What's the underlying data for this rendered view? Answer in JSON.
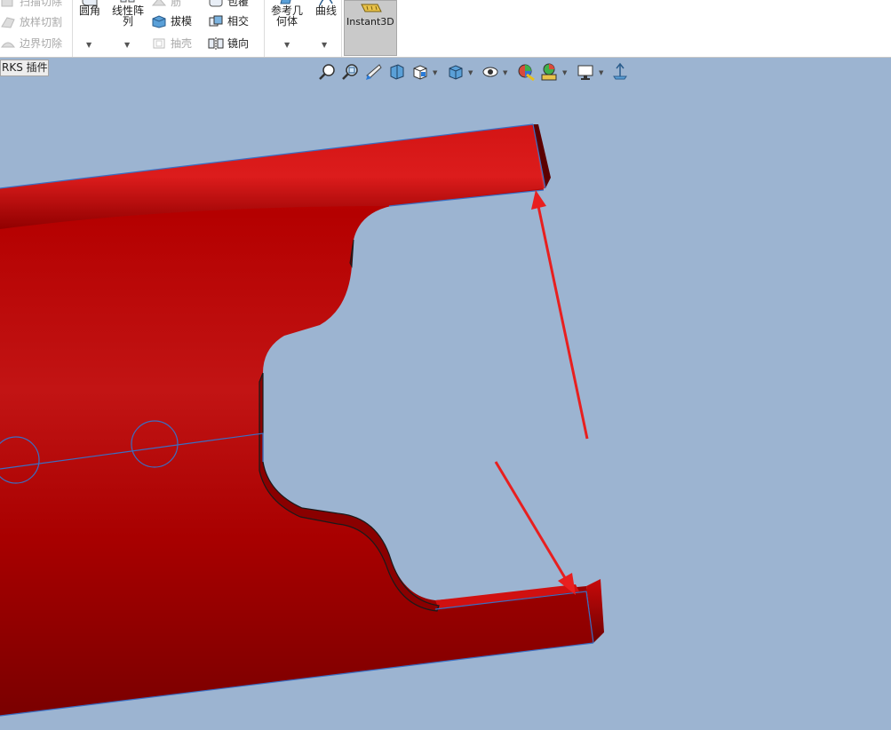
{
  "ribbon": {
    "left_items": [
      {
        "label": "扫描切除",
        "state": "disabled"
      },
      {
        "label": "放样切割",
        "state": "disabled"
      },
      {
        "label": "边界切除",
        "state": "disabled"
      }
    ],
    "fillet": "圆角",
    "linear_pattern": "线性阵列",
    "rib": "筋",
    "draft": "拔模",
    "shell": "抽壳",
    "wrap": "包覆",
    "intersect": "相交",
    "mirror": "镜向",
    "ref_geometry": "参考几何体",
    "curves": "曲线",
    "instant3d": "Instant3D"
  },
  "tabs": {
    "addins": "RKS 插件"
  },
  "heads_up_toolbar": {
    "icons": [
      "zoom-to-fit-icon",
      "zoom-to-area-icon",
      "previous-view-icon",
      "section-view-icon",
      "view-orientation-icon",
      "display-style-icon",
      "hide-show-items-icon",
      "edit-appearance-icon",
      "apply-scene-icon",
      "view-settings-icon",
      "rotate-view-icon"
    ]
  },
  "colors": {
    "viewport_background": "#9cb4d1",
    "part_red": "#b80000",
    "edge_blue": "#3a6fc4",
    "annotation_arrow": "#e81f1f",
    "instant3d_bg": "#c9c9c9"
  }
}
